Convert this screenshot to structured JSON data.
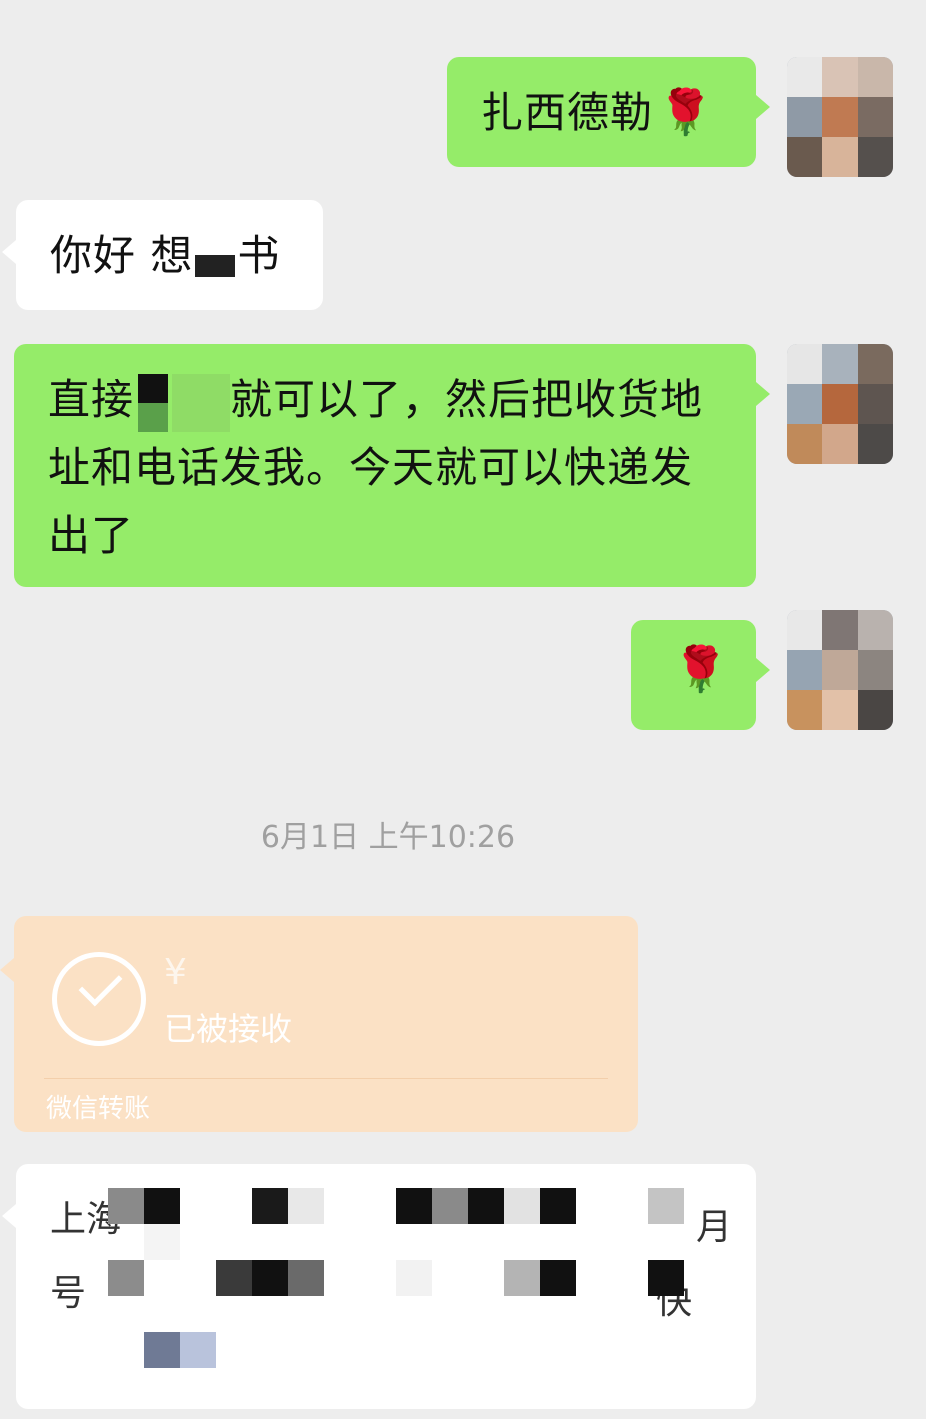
{
  "messages": [
    {
      "side": "right",
      "text": "扎西德勒",
      "emoji": "🌹"
    },
    {
      "side": "left",
      "text_prefix": "你好 想",
      "text_suffix": "书"
    },
    {
      "side": "right",
      "line1_prefix": "直接",
      "line1_suffix": "就可以了，然后把收货地",
      "line2": "址和电话发我。今天就可以快递发",
      "line3": "出了"
    },
    {
      "side": "right",
      "emoji": "🌹"
    }
  ],
  "timestamp": "6月1日 上午10:26",
  "transfer": {
    "amount": "¥",
    "status": "已被接收",
    "label": "微信转账",
    "icon": "check-circle-icon"
  },
  "last_message": {
    "visible_fragments": [
      "上海",
      "月",
      "号",
      "快"
    ]
  },
  "colors": {
    "background": "#ededed",
    "bubble_self": "#95ec69",
    "bubble_other": "#ffffff",
    "transfer_card": "#fbe1c5"
  }
}
